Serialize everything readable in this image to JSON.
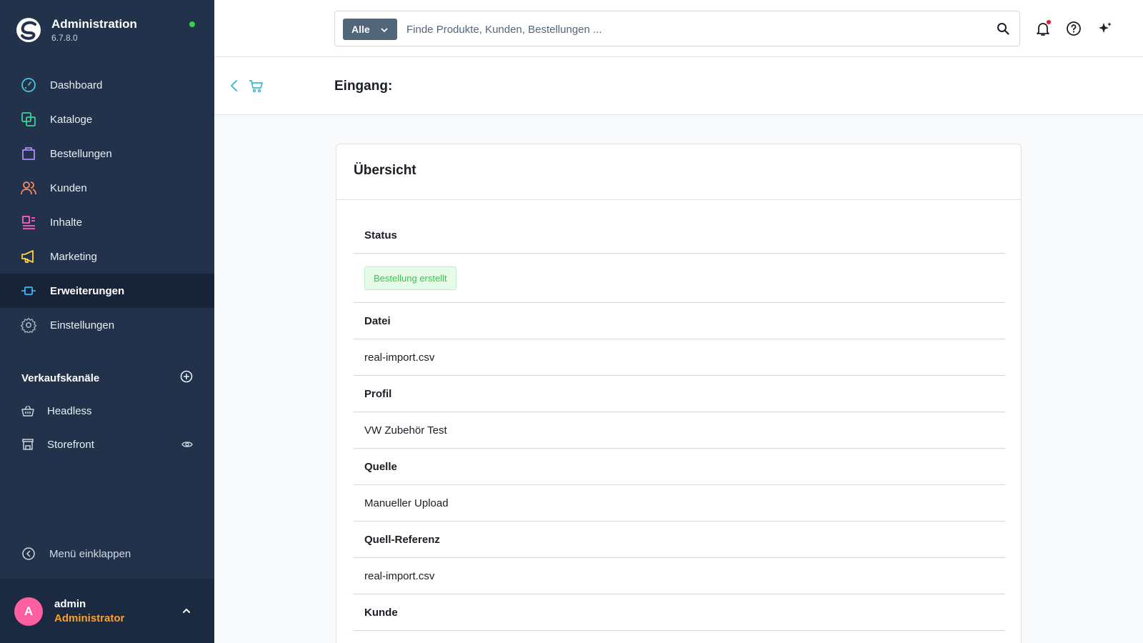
{
  "app": {
    "title": "Administration",
    "version": "6.7.8.0"
  },
  "nav": {
    "items": [
      {
        "label": "Dashboard",
        "icon": "dashboard-icon",
        "color": "#4fc3d8"
      },
      {
        "label": "Kataloge",
        "icon": "catalog-icon",
        "color": "#3ed39a"
      },
      {
        "label": "Bestellungen",
        "icon": "orders-icon",
        "color": "#b08cf5"
      },
      {
        "label": "Kunden",
        "icon": "customers-icon",
        "color": "#ff8a5c"
      },
      {
        "label": "Inhalte",
        "icon": "content-icon",
        "color": "#ff5fc0"
      },
      {
        "label": "Marketing",
        "icon": "marketing-icon",
        "color": "#ffd23a"
      },
      {
        "label": "Erweiterungen",
        "icon": "extensions-icon",
        "color": "#3cb4ff",
        "active": true
      },
      {
        "label": "Einstellungen",
        "icon": "settings-icon",
        "color": "#9aa8b8"
      }
    ]
  },
  "channels": {
    "title": "Verkaufskanäle",
    "items": [
      {
        "label": "Headless",
        "icon": "basket-icon"
      },
      {
        "label": "Storefront",
        "icon": "storefront-icon"
      }
    ]
  },
  "sidebar": {
    "collapse_label": "Menü einklappen"
  },
  "user": {
    "initial": "A",
    "name": "admin",
    "role": "Administrator"
  },
  "search": {
    "type_label": "Alle",
    "placeholder": "Finde Produkte, Kunden, Bestellungen ..."
  },
  "page": {
    "title": "Eingang:"
  },
  "card": {
    "title": "Übersicht",
    "status_label": "Status",
    "status_value": "Bestellung erstellt",
    "fields": [
      {
        "label": "Datei",
        "value": "real-import.csv"
      },
      {
        "label": "Profil",
        "value": "VW Zubehör Test"
      },
      {
        "label": "Quelle",
        "value": "Manueller Upload"
      },
      {
        "label": "Quell-Referenz",
        "value": "real-import.csv"
      },
      {
        "label": "Kunde",
        "value": ""
      }
    ]
  },
  "colors": {
    "sidebar_bg": "#22324a",
    "accent": "#189eff",
    "status_success": "#37c44b",
    "avatar": "#ff5fa0",
    "role": "#ffa026"
  }
}
